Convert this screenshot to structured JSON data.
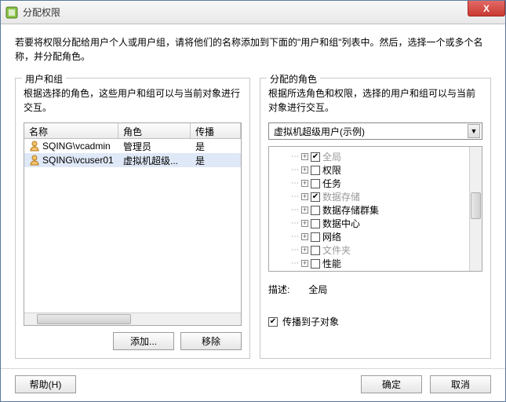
{
  "titlebar": {
    "title": "分配权限",
    "close": "X"
  },
  "intro": "若要将权限分配给用户个人或用户组，请将他们的名称添加到下面的\"用户和组\"列表中。然后，选择一个或多个名称，并分配角色。",
  "left": {
    "legend": "用户和组",
    "desc": "根据选择的角色，这些用户和组可以与当前对象进行交互。",
    "headers": {
      "name": "名称",
      "role": "角色",
      "propagate": "传播"
    },
    "rows": [
      {
        "name": "SQING\\vcadmin",
        "role": "管理员",
        "propagate": "是",
        "selected": false
      },
      {
        "name": "SQING\\vcuser01",
        "role": "虚拟机超级...",
        "propagate": "是",
        "selected": true
      }
    ],
    "add_label": "添加...",
    "remove_label": "移除"
  },
  "right": {
    "legend": "分配的角色",
    "desc": "根据所选角色和权限，选择的用户和组可以与当前对象进行交互。",
    "selected_role": "虚拟机超级用户(示例)",
    "tree": [
      {
        "label": "全局",
        "checked": true,
        "disabled": true
      },
      {
        "label": "权限",
        "checked": false,
        "disabled": false
      },
      {
        "label": "任务",
        "checked": false,
        "disabled": false
      },
      {
        "label": "数据存储",
        "checked": true,
        "disabled": true
      },
      {
        "label": "数据存储群集",
        "checked": false,
        "disabled": false
      },
      {
        "label": "数据中心",
        "checked": false,
        "disabled": false
      },
      {
        "label": "网络",
        "checked": false,
        "disabled": false
      },
      {
        "label": "文件夹",
        "checked": false,
        "disabled": true
      },
      {
        "label": "性能",
        "checked": false,
        "disabled": false
      }
    ],
    "desc_label": "描述:",
    "desc_value": "全局",
    "propagate_label": "传播到子对象",
    "propagate_checked": true
  },
  "footer": {
    "help": "帮助(H)",
    "ok": "确定",
    "cancel": "取消"
  }
}
